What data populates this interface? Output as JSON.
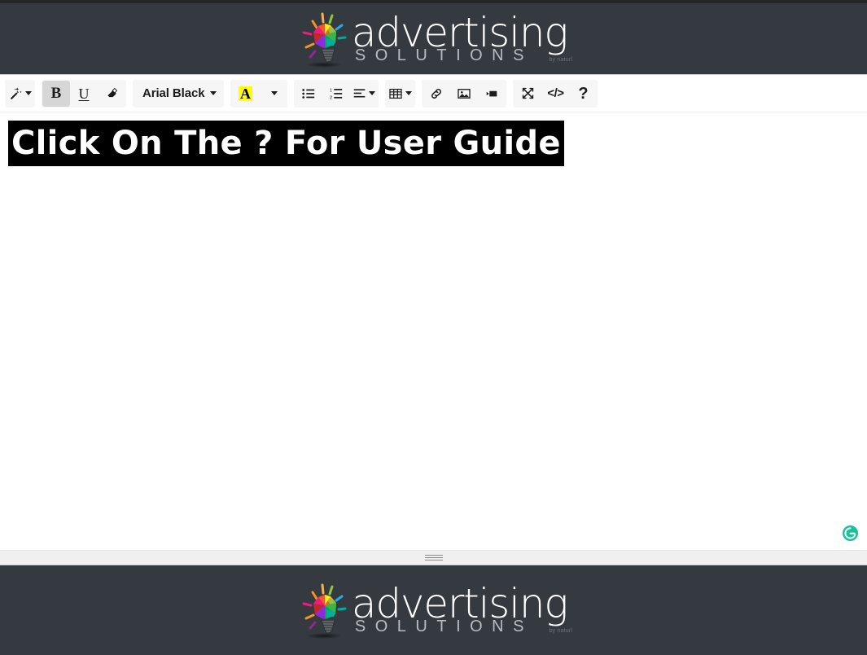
{
  "brand": {
    "name_top": "advertising",
    "name_bottom": "SOLUTIONS",
    "tagline": "by naturl",
    "logo_icon": "lightbulb-icon",
    "bar_color": "#343a40"
  },
  "toolbar": {
    "groups": [
      {
        "name": "style-group",
        "buttons": [
          {
            "name": "magic-wand-button",
            "icon": "magic-wand-icon",
            "label": "",
            "has_caret": true,
            "active": false
          }
        ]
      },
      {
        "name": "text-format-group",
        "buttons": [
          {
            "name": "bold-button",
            "icon": "bold-icon",
            "label": "B",
            "has_caret": false,
            "active": true
          },
          {
            "name": "underline-button",
            "icon": "underline-icon",
            "label": "U",
            "has_caret": false,
            "active": false
          },
          {
            "name": "clear-formatting-button",
            "icon": "eraser-icon",
            "label": "",
            "has_caret": false,
            "active": false
          }
        ]
      },
      {
        "name": "font-group",
        "buttons": [
          {
            "name": "font-family-button",
            "icon": "font-family-icon",
            "label": "Arial Black",
            "has_caret": true,
            "active": false
          }
        ]
      },
      {
        "name": "color-group",
        "buttons": [
          {
            "name": "text-color-button",
            "icon": "text-color-icon",
            "label": "A",
            "has_caret": true,
            "active": false
          }
        ]
      },
      {
        "name": "list-group",
        "buttons": [
          {
            "name": "unordered-list-button",
            "icon": "unordered-list-icon",
            "label": "",
            "has_caret": false,
            "active": false
          },
          {
            "name": "ordered-list-button",
            "icon": "ordered-list-icon",
            "label": "",
            "has_caret": false,
            "active": false
          },
          {
            "name": "align-button",
            "icon": "align-left-icon",
            "label": "",
            "has_caret": true,
            "active": false
          }
        ]
      },
      {
        "name": "table-group",
        "buttons": [
          {
            "name": "insert-table-button",
            "icon": "table-icon",
            "label": "",
            "has_caret": true,
            "active": false
          }
        ]
      },
      {
        "name": "insert-group",
        "buttons": [
          {
            "name": "insert-link-button",
            "icon": "link-icon",
            "label": "",
            "has_caret": false,
            "active": false
          },
          {
            "name": "insert-image-button",
            "icon": "image-icon",
            "label": "",
            "has_caret": false,
            "active": false
          },
          {
            "name": "insert-video-button",
            "icon": "video-icon",
            "label": "",
            "has_caret": false,
            "active": false
          }
        ]
      },
      {
        "name": "view-group",
        "buttons": [
          {
            "name": "fullscreen-button",
            "icon": "fullscreen-icon",
            "label": "",
            "has_caret": false,
            "active": false
          },
          {
            "name": "code-view-button",
            "icon": "code-icon",
            "label": "</>",
            "has_caret": false,
            "active": false
          },
          {
            "name": "help-button",
            "icon": "question-mark-icon",
            "label": "?",
            "has_caret": false,
            "active": false
          }
        ]
      }
    ],
    "font_family_value": "Arial Black",
    "highlight_color": "#ffff00"
  },
  "editor": {
    "heading_text": "Click On The ? For User Guide",
    "heading_background": "#000000",
    "heading_color": "#ffffff",
    "heading_font": "Arial Black"
  },
  "grammarly": {
    "name": "grammarly-badge",
    "letter": "G",
    "color": "#15c39a"
  },
  "resize": {
    "name": "editor-resize-handle"
  }
}
